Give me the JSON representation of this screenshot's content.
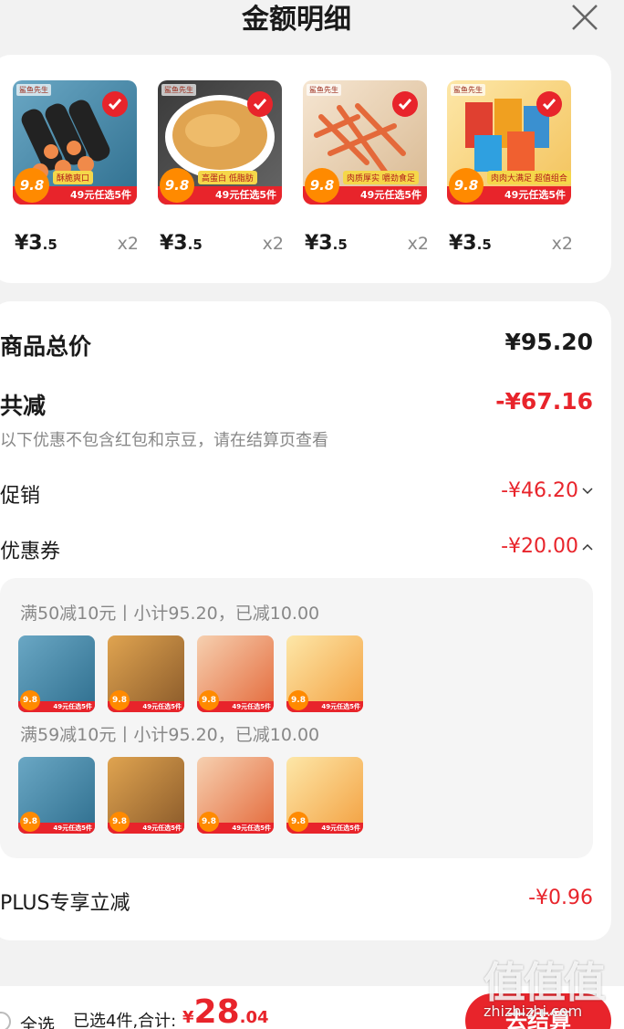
{
  "header": {
    "title": "金额明细",
    "close_icon": "close-icon"
  },
  "products": [
    {
      "name": "seaweed-rolls",
      "bar": "49元任选5件",
      "tag": "9.8",
      "sub": "酥脆爽口",
      "price_int": "¥3",
      "price_dec": ".5",
      "qty": "x2",
      "bg": "#5a9bb8"
    },
    {
      "name": "egg-pancake",
      "bar": "49元任选5件",
      "tag": "9.8",
      "sub": "高蛋白 低脂肪",
      "price_int": "¥3",
      "price_dec": ".5",
      "qty": "x2",
      "bg": "#c78a3a"
    },
    {
      "name": "shredded-squid",
      "bar": "49元任选5件",
      "tag": "9.8",
      "sub": "肉质厚实 嚼劲食足",
      "price_int": "¥3",
      "price_dec": ".5",
      "qty": "x2",
      "bg": "#e8a05a"
    },
    {
      "name": "snack-combo",
      "bar": "49元任选5件",
      "tag": "9.8",
      "sub": "肉肉大满足 超值组合",
      "price_int": "¥3",
      "price_dec": ".5",
      "qty": "x2",
      "bg": "#f0b040"
    }
  ],
  "summary": {
    "total_label": "商品总价",
    "total_value": "¥95.20",
    "discount_label": "共减",
    "discount_value": "-¥67.16",
    "note": "以下优惠不包含红包和京豆，请在结算页查看",
    "promo_label": "促销",
    "promo_value": "-¥46.20",
    "coupon_label": "优惠券",
    "coupon_value": "-¥20.00",
    "plus_label": "PLUS专享立减",
    "plus_value": "-¥0.96"
  },
  "coupons": [
    {
      "text": "满50减10元丨小计95.20，已减10.00"
    },
    {
      "text": "满59减10元丨小计95.20，已减10.00"
    }
  ],
  "mini_bar": "49元任选5件",
  "mini_tag": "9.8",
  "bottom": {
    "select_all": "全选",
    "selected_text": "已选4件,合计:",
    "currency": "¥",
    "total_int": "28",
    "total_dec": ".04",
    "checkout": "去结算"
  },
  "watermark": {
    "big": "值值值",
    "small": "zhizhizhi.com"
  },
  "colors": {
    "accent": "#e8242b",
    "orange": "#ff8a00"
  }
}
